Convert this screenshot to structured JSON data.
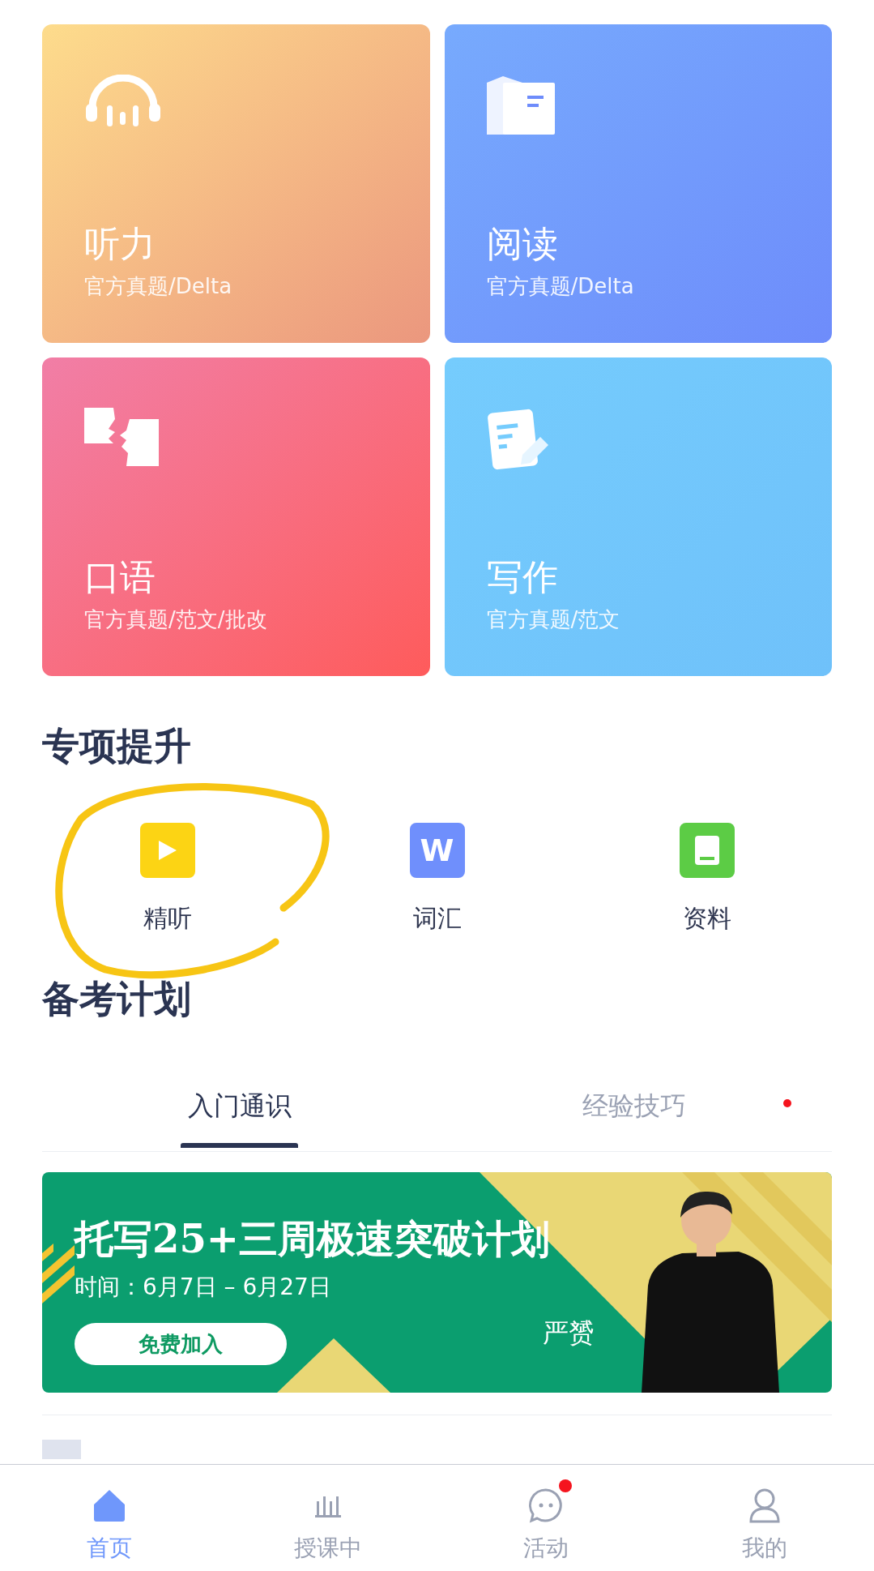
{
  "cards": [
    {
      "kind": "listening",
      "title": "听力",
      "subtitle": "官方真题/Delta"
    },
    {
      "kind": "reading",
      "title": "阅读",
      "subtitle": "官方真题/Delta"
    },
    {
      "kind": "speaking",
      "title": "口语",
      "subtitle": "官方真题/范文/批改"
    },
    {
      "kind": "writing",
      "title": "写作",
      "subtitle": "官方真题/范文"
    }
  ],
  "special": {
    "title": "专项提升",
    "items": [
      {
        "kind": "play",
        "label": "精听"
      },
      {
        "kind": "letter",
        "icon_text": "W",
        "label": "词汇"
      },
      {
        "kind": "book",
        "label": "资料"
      }
    ]
  },
  "plan": {
    "title": "备考计划",
    "tabs": [
      {
        "label": "入门通识",
        "selected": true,
        "badge": false
      },
      {
        "label": "经验技巧",
        "selected": false,
        "badge": true
      }
    ]
  },
  "banner": {
    "title": "托写25+三周极速突破计划",
    "time": "时间：6月7日 – 6月27日",
    "button": "免费加入",
    "teacher": "严赟"
  },
  "list": [
    {
      "kind": "article"
    }
  ],
  "nav": [
    {
      "kind": "home",
      "label": "首页",
      "selected": true,
      "badge": false
    },
    {
      "kind": "live",
      "label": "授课中",
      "selected": false,
      "badge": false
    },
    {
      "kind": "chat",
      "label": "活动",
      "selected": false,
      "badge": true
    },
    {
      "kind": "profile",
      "label": "我的",
      "selected": false,
      "badge": false
    }
  ],
  "annotation": {
    "kind": "circle"
  }
}
